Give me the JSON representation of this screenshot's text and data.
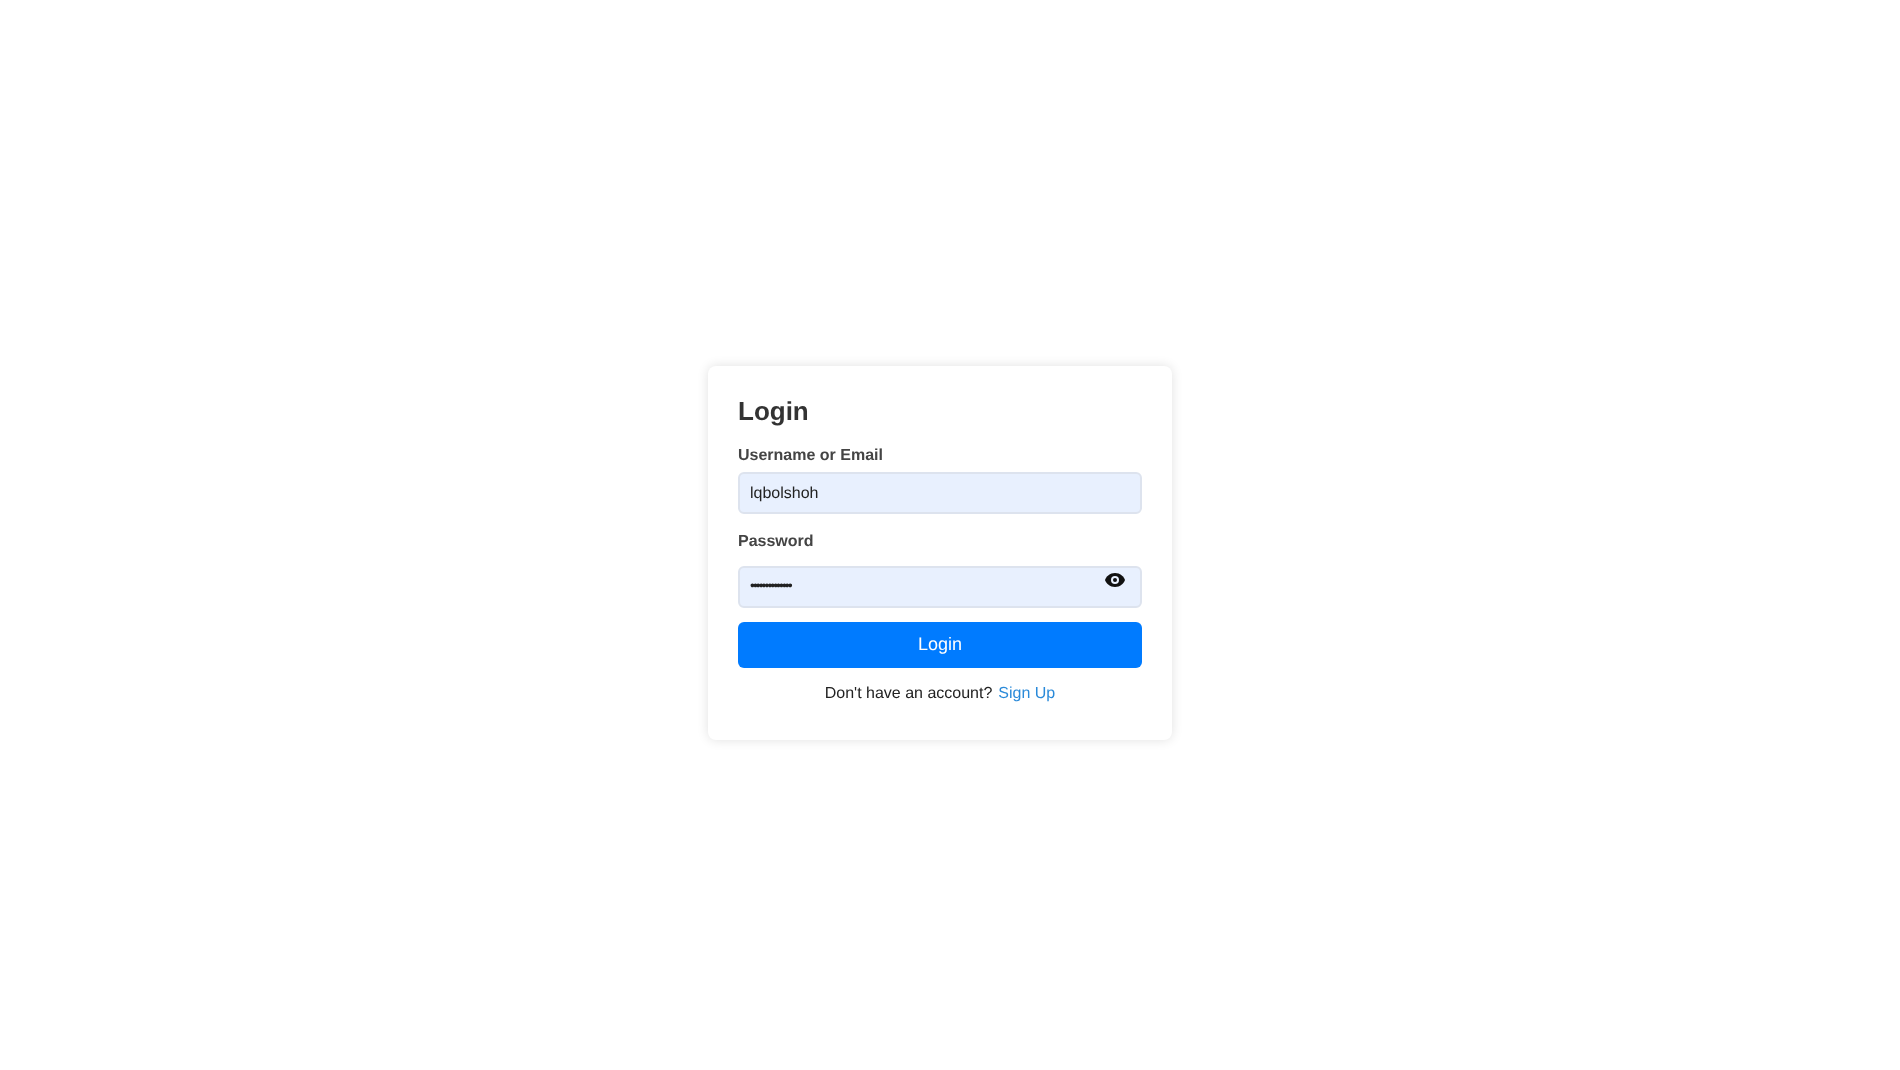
{
  "form": {
    "title": "Login",
    "username": {
      "label": "Username or Email",
      "value": "lqbolshoh"
    },
    "password": {
      "label": "Password",
      "value": "••••••••••••••"
    },
    "submit": "Login",
    "signup_prompt": "Don't have an account?",
    "signup_link": "Sign Up"
  }
}
